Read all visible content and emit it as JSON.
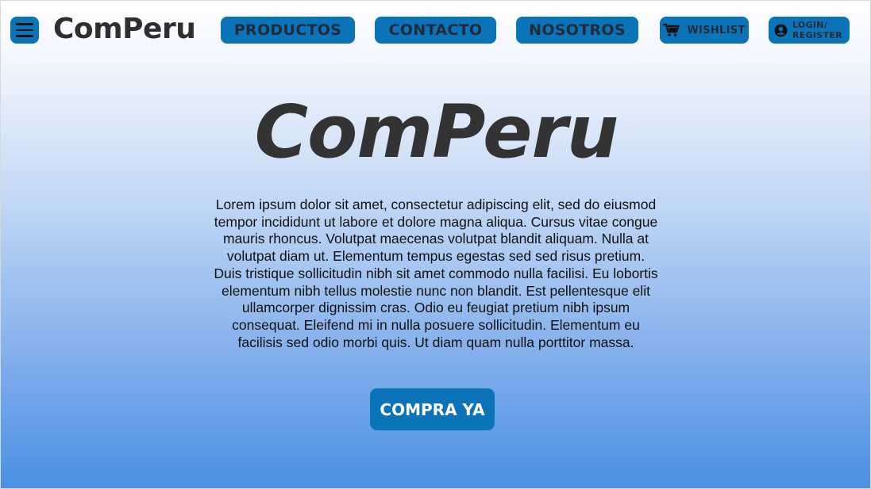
{
  "header": {
    "logo": "ComPeru",
    "menu_icon": "hamburger-menu-icon",
    "nav": {
      "productos": "PRODUCTOS",
      "contacto": "CONTACTO",
      "nosotros": "NOSOTROS",
      "wishlist": "WISHLIST",
      "wishlist_icon": "shopping-cart-icon",
      "login": "LOGIN/ REGISTER",
      "login_icon": "user-circle-icon"
    }
  },
  "hero": {
    "title": "ComPeru",
    "body": "Lorem ipsum dolor sit amet, consectetur adipiscing elit, sed do eiusmod tempor incididunt ut labore et dolore magna aliqua. Cursus vitae congue mauris rhoncus. Volutpat maecenas volutpat blandit aliquam. Nulla at volutpat diam ut. Elementum tempus egestas sed sed risus pretium. Duis tristique sollicitudin nibh sit amet commodo nulla facilisi. Eu lobortis elementum nibh tellus molestie nunc non blandit. Est pellentesque elit ullamcorper dignissim cras. Odio eu feugiat pretium nibh ipsum consequat. Eleifend mi in nulla posuere sollicitudin. Elementum eu facilisis sed odio morbi quis. Ut diam quam nulla porttitor massa.",
    "cta": "COMPRA YA"
  },
  "colors": {
    "accent": "#0b74b9",
    "gradient_top": "#ffffff",
    "gradient_bottom": "#4a90e2",
    "text_dark": "#333333"
  }
}
